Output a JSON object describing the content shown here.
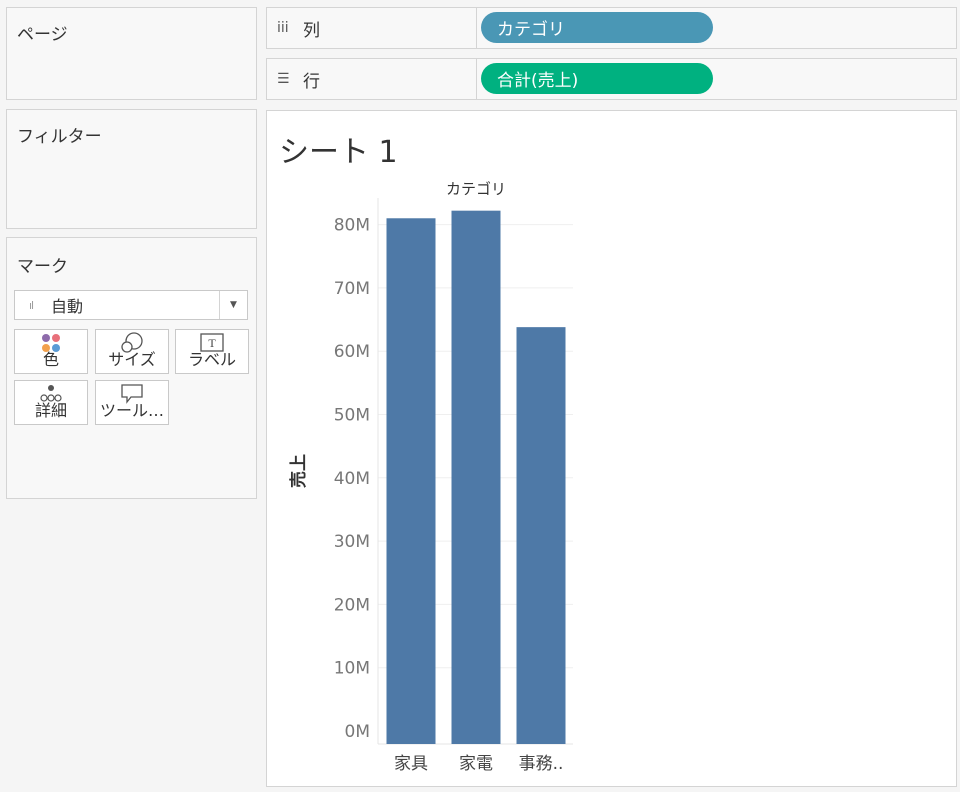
{
  "pages_panel": {
    "title": "ページ"
  },
  "filters_panel": {
    "title": "フィルター"
  },
  "marks_panel": {
    "title": "マーク",
    "mark_type": "自動",
    "buttons": [
      {
        "label": "色",
        "icon": "color-icon"
      },
      {
        "label": "サイズ",
        "icon": "size-icon"
      },
      {
        "label": "ラベル",
        "icon": "label-icon"
      },
      {
        "label": "詳細",
        "icon": "detail-icon"
      },
      {
        "label": "ツール…",
        "icon": "tooltip-icon"
      }
    ]
  },
  "columns_shelf": {
    "label": "列",
    "pill": "カテゴリ",
    "pill_color": "#4a97b5"
  },
  "rows_shelf": {
    "label": "行",
    "pill": "合計(売上)",
    "pill_color": "#00b180"
  },
  "view": {
    "sheet_title": "シート 1"
  },
  "colors": {
    "bar": "#4e79a7"
  },
  "chart_data": {
    "type": "bar",
    "column_header": "カテゴリ",
    "categories": [
      "家具",
      "家電",
      "事務.."
    ],
    "values": [
      81,
      82.2,
      63.8
    ],
    "value_unit": "M",
    "ylabel": "売上",
    "ylim": [
      0,
      85
    ],
    "yticks": [
      "0M",
      "10M",
      "20M",
      "30M",
      "40M",
      "50M",
      "60M",
      "70M",
      "80M"
    ],
    "grid": true
  }
}
